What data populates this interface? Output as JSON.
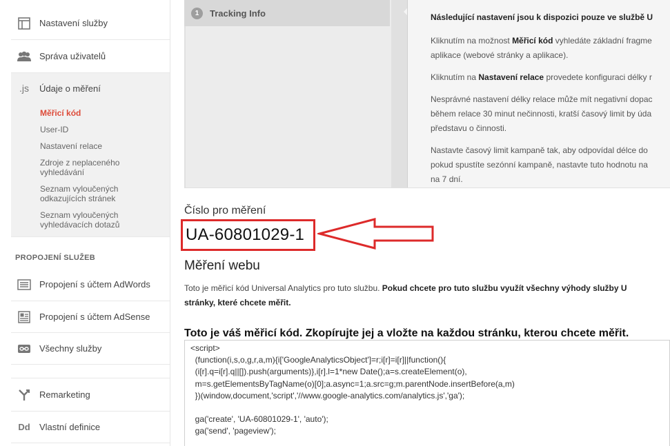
{
  "sidebar": {
    "items": [
      {
        "label": "Nastavení služby",
        "icon": "window-icon"
      },
      {
        "label": "Správa uživatelů",
        "icon": "users-icon"
      },
      {
        "label": "Údaje o měření",
        "icon": "js-icon",
        "icon_text": ".js"
      }
    ],
    "subitems": [
      "Měřicí kód",
      "User-ID",
      "Nastavení relace",
      "Zdroje z neplaceného vyhledávání",
      "Seznam vyloučených odkazujících stránek",
      "Seznam vyloučených vyhledávacích dotazů"
    ],
    "section_title": "PROPOJENÍ SLUŽEB",
    "links": [
      {
        "label": "Propojení s účtem AdWords",
        "icon": "adwords-icon"
      },
      {
        "label": "Propojení s účtem AdSense",
        "icon": "adsense-icon"
      },
      {
        "label": "Všechny služby",
        "icon": "link-icon"
      },
      {
        "label": "Remarketing",
        "icon": "remarketing-icon"
      },
      {
        "label": "Vlastní definice",
        "icon": "dd-icon",
        "icon_text": "Dd"
      }
    ]
  },
  "step": {
    "number": "1",
    "label": "Tracking Info"
  },
  "info": {
    "lead": "Následující nastavení jsou k dispozici pouze ve službě U",
    "p1_pre": "Kliknutím na možnost ",
    "p1_bold": "Měřicí kód",
    "p1_post": " vyhledáte základní fragme",
    "p1_line2": "aplikace (webové stránky a aplikace).",
    "p2_pre": "Kliknutím na ",
    "p2_bold": "Nastavení relace",
    "p2_post": " provedete konfiguraci délky r",
    "p3_line1": "Nesprávné nastavení délky relace může mít negativní dopac",
    "p3_line2": "během relace 30 minut nečinnosti, kratší časový limit by úda",
    "p3_line3": "představu o činnosti.",
    "p4_line1": "Nastavte časový limit kampaně tak, aby odpovídal délce do",
    "p4_line2": "pokud spustíte sezónní kampaně, nastavte tuto hodnotu na",
    "p4_line3": "na 7 dní."
  },
  "tracking": {
    "label": "Číslo pro měření",
    "id": "UA-60801029-1"
  },
  "web": {
    "title": "Měření webu",
    "desc_pre": "Toto je měřicí kód Universal Analytics pro tuto službu. ",
    "desc_bold": "Pokud chcete pro tuto službu využít všechny výhody služby U",
    "desc_line2": "stránky, které chcete měřit."
  },
  "code": {
    "title": "Toto je váš měřicí kód. Zkopírujte jej a vložte na každou stránku, kterou chcete měřit.",
    "snippet": "<script>\n  (function(i,s,o,g,r,a,m){i['GoogleAnalyticsObject']=r;i[r]=i[r]||function(){\n  (i[r].q=i[r].q||[]).push(arguments)},i[r].l=1*new Date();a=s.createElement(o),\n  m=s.getElementsByTagName(o)[0];a.async=1;a.src=g;m.parentNode.insertBefore(a,m)\n  })(window,document,'script','//www.google-analytics.com/analytics.js','ga');\n\n  ga('create', 'UA-60801029-1', 'auto');\n  ga('send', 'pageview');"
  },
  "colors": {
    "highlight": "#dd2a2a",
    "active_nav": "#dd4b39"
  }
}
